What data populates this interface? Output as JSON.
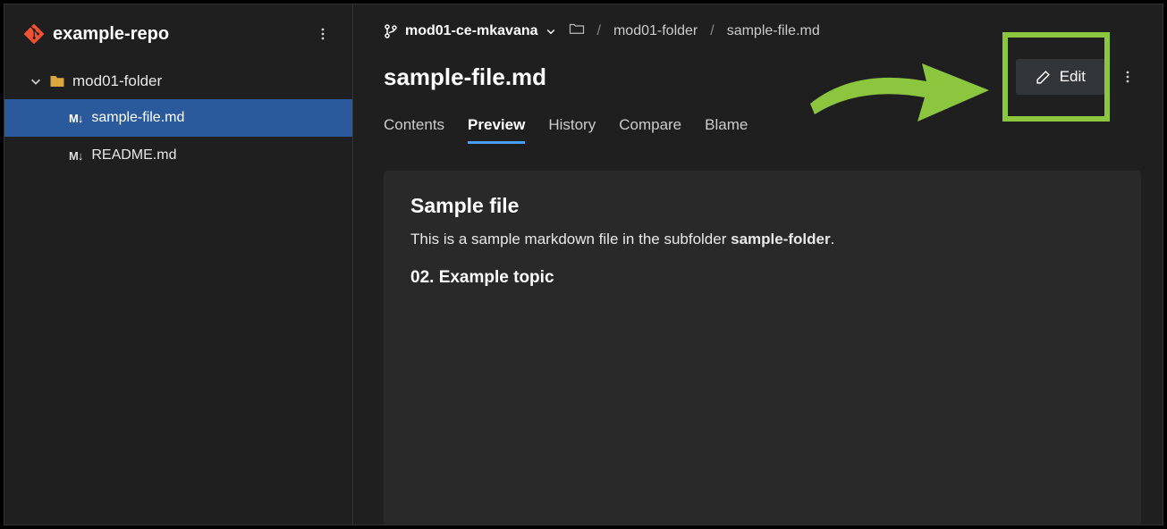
{
  "sidebar": {
    "repo_name": "example-repo",
    "folder": "mod01-folder",
    "files": [
      {
        "name": "sample-file.md",
        "selected": true
      },
      {
        "name": "README.md",
        "selected": false
      }
    ]
  },
  "breadcrumb": {
    "branch": "mod01-ce-mkavana",
    "folder": "mod01-folder",
    "file": "sample-file.md"
  },
  "file": {
    "title": "sample-file.md",
    "edit_label": "Edit"
  },
  "tabs": {
    "contents": "Contents",
    "preview": "Preview",
    "history": "History",
    "compare": "Compare",
    "blame": "Blame"
  },
  "preview": {
    "heading": "Sample file",
    "body_prefix": "This is a sample markdown file in the subfolder ",
    "body_strong": "sample-folder",
    "body_suffix": ".",
    "subheading": "02. Example topic"
  },
  "annotation": {
    "arrow_color": "#8cc63f"
  }
}
